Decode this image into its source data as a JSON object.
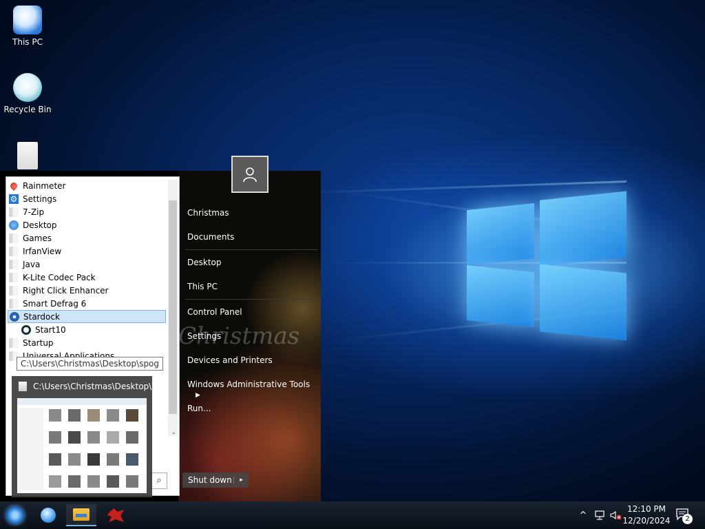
{
  "desktop": {
    "icons": [
      {
        "label": "This PC",
        "icon": "this-pc-icon"
      },
      {
        "label": "Recycle Bin",
        "icon": "recycle-bin-icon"
      },
      {
        "label": "",
        "icon": "file-icon"
      }
    ]
  },
  "start_menu": {
    "programs": [
      {
        "label": "Rainmeter",
        "icon": "rainmeter-icon"
      },
      {
        "label": "Settings",
        "icon": "gear-icon"
      },
      {
        "label": "7-Zip",
        "icon": "folder-icon"
      },
      {
        "label": "Desktop",
        "icon": "desktop-icon"
      },
      {
        "label": "Games",
        "icon": "folder-icon"
      },
      {
        "label": "IrfanView",
        "icon": "folder-icon"
      },
      {
        "label": "Java",
        "icon": "folder-icon"
      },
      {
        "label": "K-Lite Codec Pack",
        "icon": "folder-icon"
      },
      {
        "label": "Right Click Enhancer",
        "icon": "folder-icon"
      },
      {
        "label": "Smart Defrag 6",
        "icon": "folder-icon"
      },
      {
        "label": "Stardock",
        "icon": "stardock-icon",
        "selected": true
      },
      {
        "label": "Start10",
        "icon": "start10-icon",
        "indent": true
      },
      {
        "label": "Startup",
        "icon": "folder-icon"
      },
      {
        "label": "Universal Applications",
        "icon": "folder-icon"
      }
    ],
    "user_tile": "user-avatar-icon",
    "right_items": {
      "christmas": "Christmas",
      "documents": "Documents",
      "desktop": "Desktop",
      "this_pc": "This PC",
      "control_panel": "Control Panel",
      "settings": "Settings",
      "devices_printers": "Devices and Printers",
      "admin_tools": "Windows Administrative Tools",
      "run": "Run..."
    },
    "background_text": "Christmas",
    "shutdown_label": "Shut down",
    "shutdown_arrow": "▸",
    "search_icon": "⌕"
  },
  "tooltip": {
    "text": "C:\\Users\\Christmas\\Desktop\\spog"
  },
  "taskbar_preview": {
    "title": "C:\\Users\\Christmas\\Desktop\\..."
  },
  "taskbar": {
    "start_icon": "start10-orb-icon",
    "pinned": [
      {
        "name": "internet-browser-icon",
        "active": false
      },
      {
        "name": "file-explorer-icon",
        "active": true
      },
      {
        "name": "red-dragon-app-icon",
        "active": false
      }
    ],
    "tray": {
      "chevron": "^",
      "network_icon": "network-icon",
      "volume_icon": "volume-muted-icon"
    },
    "clock": {
      "time": "12:10 PM",
      "date": "12/20/2024"
    },
    "notification_count": "2"
  },
  "colors": {
    "accent": "#1e8be6",
    "selection": "#cfe4f7",
    "selection_border": "#7eb4ea"
  }
}
